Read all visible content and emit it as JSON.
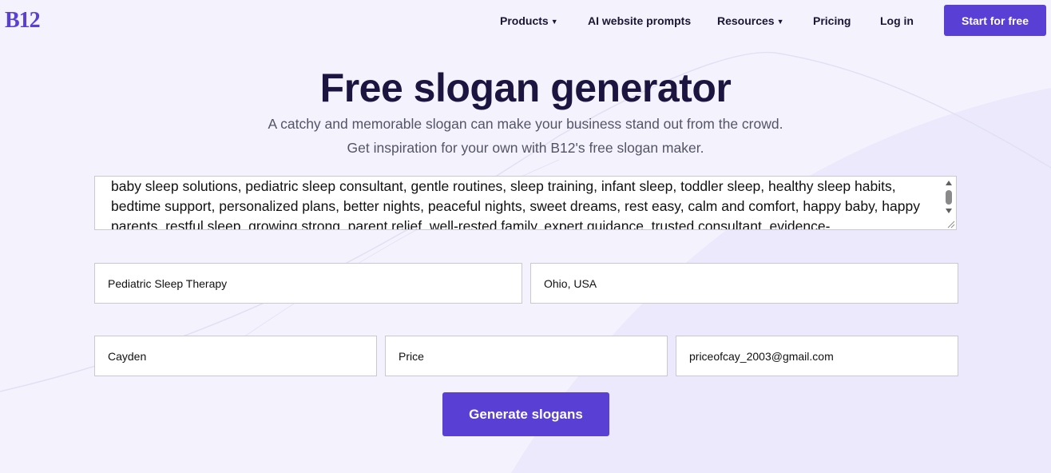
{
  "brand": {
    "logo_text": "B12",
    "accent_color": "#5a3fd4"
  },
  "nav": {
    "items": [
      {
        "label": "Products",
        "has_dropdown": true
      },
      {
        "label": "AI website prompts",
        "has_dropdown": false
      },
      {
        "label": "Resources",
        "has_dropdown": true
      },
      {
        "label": "Pricing",
        "has_dropdown": false
      },
      {
        "label": "Log in",
        "has_dropdown": false
      }
    ],
    "cta_label": "Start for free",
    "dropdown_icon": "chevron-down-icon"
  },
  "hero": {
    "title": "Free slogan generator",
    "subtitle_line1": "A catchy and memorable slogan can make your business stand out from the crowd.",
    "subtitle_line2": "Get inspiration for your own with B12's free slogan maker."
  },
  "form": {
    "keywords_value": "baby sleep solutions, pediatric sleep consultant, gentle routines, sleep training, infant sleep, toddler sleep, healthy sleep habits, bedtime support, personalized plans, better nights, peaceful nights, sweet dreams, rest easy, calm and comfort, happy baby, happy parents, restful sleep, growing strong, parent relief, well-rested family, expert guidance, trusted consultant, evidence-",
    "business_name_value": "Pediatric Sleep Therapy",
    "location_value": "Ohio, USA",
    "first_name_value": "Cayden",
    "last_name_value": "Price",
    "email_value": "priceofcay_2003@gmail.com",
    "submit_label": "Generate slogans"
  }
}
